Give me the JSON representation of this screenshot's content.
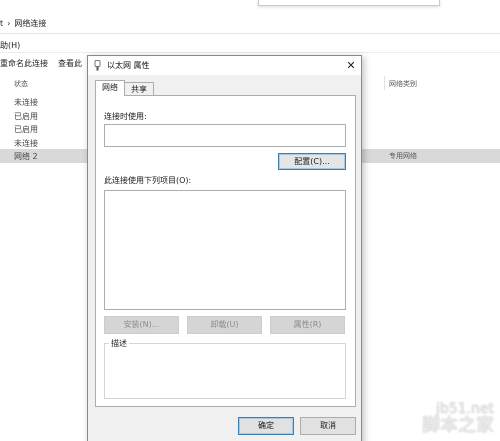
{
  "explorer": {
    "breadcrumb": [
      "t",
      "›",
      "网络连接"
    ],
    "menu": "助(H)",
    "toolbar": [
      "重命名此连接",
      "查看此"
    ],
    "column_status": "状态",
    "column_category": "网络类别",
    "rows": [
      {
        "status": "未连接",
        "category": ""
      },
      {
        "status": "已启用",
        "category": ""
      },
      {
        "status": "已启用",
        "category": ""
      },
      {
        "status": "未连接",
        "category": ""
      },
      {
        "status": "网络  2",
        "category": "专用网络"
      }
    ]
  },
  "dialog": {
    "title": "以太网 属性",
    "close_glyph": "✕",
    "tabs": [
      {
        "label": "网络",
        "active": true
      },
      {
        "label": "共享",
        "active": false
      }
    ],
    "connect_using_label": "连接时使用:",
    "adapter_value": "",
    "configure_label": "配置(C)...",
    "items_label": "此连接使用下列项目(O):",
    "items": [],
    "install_label": "安装(N)...",
    "uninstall_label": "卸载(U)",
    "properties_label": "属性(R)",
    "description_label": "描述",
    "description_text": "",
    "ok_label": "确定",
    "cancel_label": "取消"
  },
  "watermark": {
    "domain": "jb51.net",
    "name": "脚本之家"
  },
  "colors": {
    "focus_blue": "#3c7fb1",
    "dialog_bg": "#f0f0f0",
    "selected_row": "#d9d9d9"
  },
  "icons": {
    "title": "network-adapter-icon",
    "close": "close-icon"
  }
}
